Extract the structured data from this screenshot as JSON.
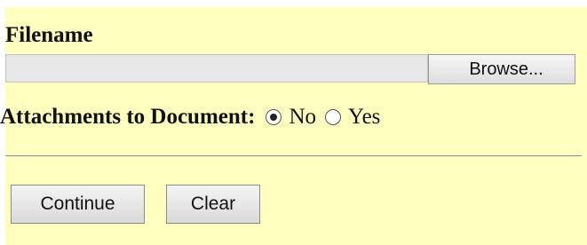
{
  "form": {
    "filename_label": "Filename",
    "file_path_value": "",
    "browse_label": "Browse...",
    "attachments_label": "Attachments to Document:",
    "attachments_options": [
      {
        "label": "No",
        "selected": true
      },
      {
        "label": "Yes",
        "selected": false
      }
    ]
  },
  "actions": {
    "continue_label": "Continue",
    "clear_label": "Clear"
  },
  "colors": {
    "panel_background": "#ffffc0",
    "input_background": "#e6e6e6",
    "button_background": "#e6e6e6"
  }
}
